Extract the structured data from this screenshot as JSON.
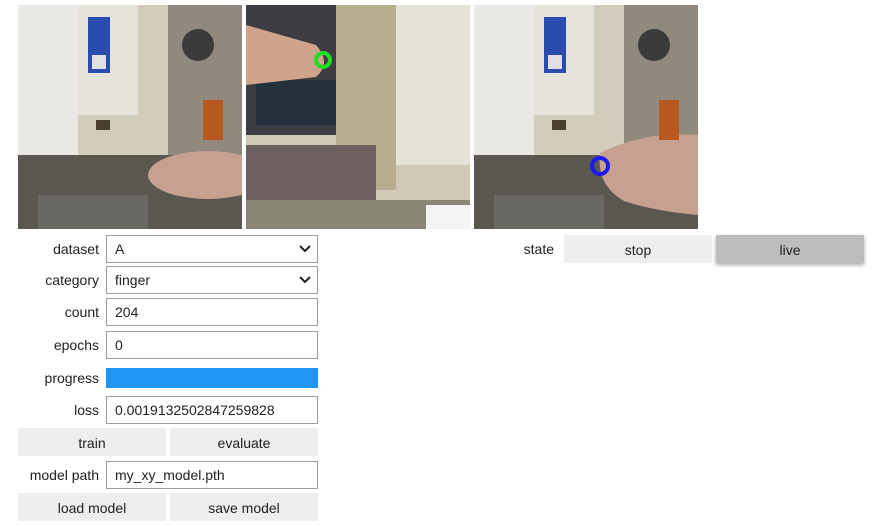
{
  "controls": {
    "dataset": {
      "label": "dataset",
      "value": "A"
    },
    "category": {
      "label": "category",
      "value": "finger"
    },
    "count": {
      "label": "count",
      "value": "204"
    },
    "epochs": {
      "label": "epochs",
      "value": "0"
    },
    "progress": {
      "label": "progress",
      "fraction": 1.0,
      "color": "#2196f3"
    },
    "loss": {
      "label": "loss",
      "value": "0.0019132502847259828"
    },
    "model_path": {
      "label": "model path",
      "value": "my_xy_model.pth"
    }
  },
  "buttons": {
    "train": "train",
    "evaluate": "evaluate",
    "load_model": "load model",
    "save_model": "save model"
  },
  "state": {
    "label": "state",
    "options": [
      "stop",
      "live"
    ],
    "selected": "live"
  },
  "overlays": {
    "capture_marker_color": "#22dd22",
    "prediction_marker_color": "#1a1aee"
  }
}
